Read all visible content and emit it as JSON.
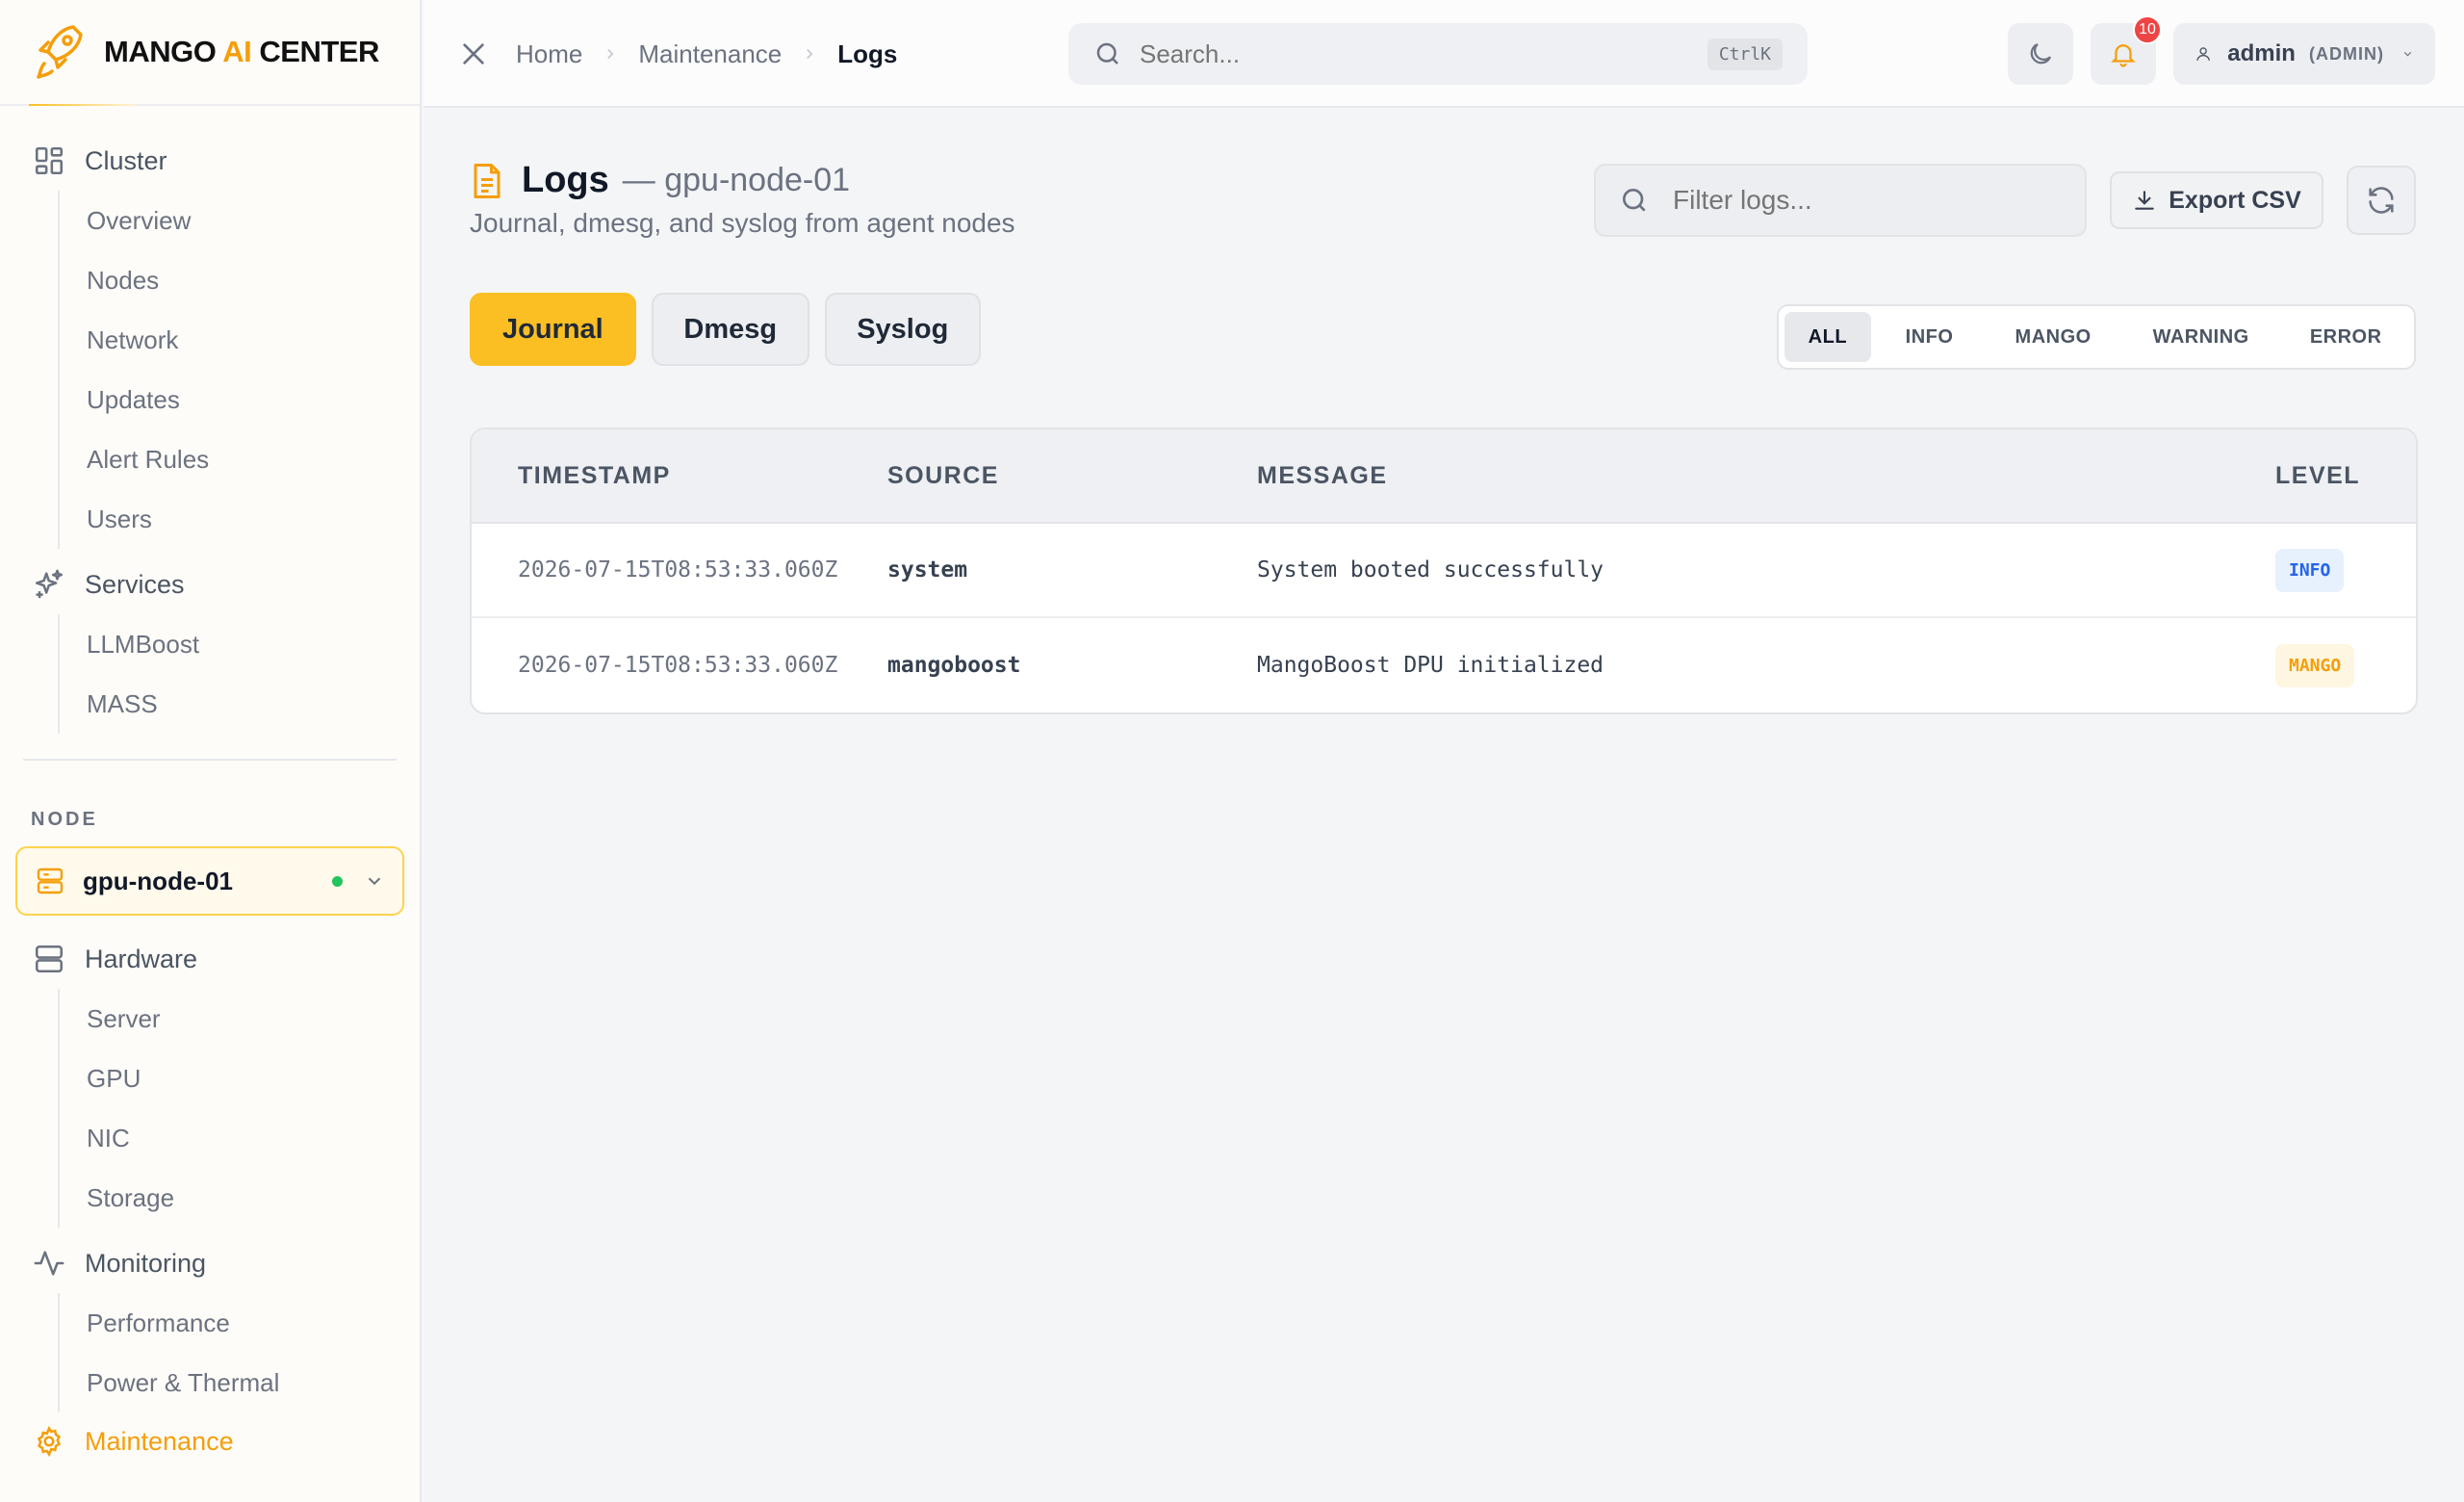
{
  "brand": {
    "name_prefix": "MANGO ",
    "name_ai": "AI",
    "name_suffix": " CENTER"
  },
  "sidebar": {
    "cluster": {
      "label": "Cluster",
      "items": [
        "Overview",
        "Nodes",
        "Network",
        "Updates",
        "Alert Rules",
        "Users"
      ]
    },
    "services": {
      "label": "Services",
      "items": [
        "LLMBoost",
        "MASS"
      ]
    },
    "node_label": "NODE",
    "node_select": "gpu-node-01",
    "hardware": {
      "label": "Hardware",
      "items": [
        "Server",
        "GPU",
        "NIC",
        "Storage"
      ]
    },
    "monitoring": {
      "label": "Monitoring",
      "items": [
        "Performance",
        "Power & Thermal"
      ]
    },
    "maintenance": {
      "label": "Maintenance"
    }
  },
  "topbar": {
    "breadcrumb": [
      "Home",
      "Maintenance",
      "Logs"
    ],
    "search_placeholder": "Search...",
    "search_shortcut": "CtrlK",
    "notification_count": "10",
    "user_name": "admin",
    "user_role": "(ADMIN)"
  },
  "page": {
    "title": "Logs",
    "title_node": "— gpu-node-01",
    "subtitle": "Journal, dmesg, and syslog from agent nodes",
    "filter_placeholder": "Filter logs...",
    "export_label": "Export CSV"
  },
  "tabs": [
    "Journal",
    "Dmesg",
    "Syslog"
  ],
  "level_filters": [
    "ALL",
    "INFO",
    "MANGO",
    "WARNING",
    "ERROR"
  ],
  "table": {
    "headers": [
      "TIMESTAMP",
      "SOURCE",
      "MESSAGE",
      "LEVEL"
    ],
    "rows": [
      {
        "timestamp": "2026-07-15T08:53:33.060Z",
        "source": "system",
        "message": "System booted successfully",
        "level": "INFO"
      },
      {
        "timestamp": "2026-07-15T08:53:33.060Z",
        "source": "mangoboost",
        "message": "MangoBoost DPU initialized",
        "level": "MANGO"
      }
    ]
  },
  "colors": {
    "accent": "#fbbf24",
    "accent_text": "#f59e0b",
    "info": "#2563eb",
    "notification": "#ef4444",
    "node_online": "#22c55e"
  }
}
